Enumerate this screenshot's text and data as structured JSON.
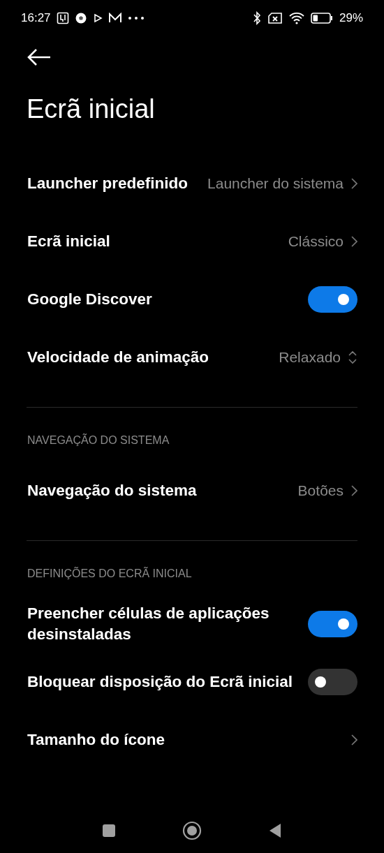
{
  "status_bar": {
    "time": "16:27",
    "battery_text": "29%"
  },
  "title": "Ecrã inicial",
  "sections": [
    {
      "items": [
        {
          "kind": "link",
          "label": "Launcher predefinido",
          "value": "Launcher do sistema"
        },
        {
          "kind": "link",
          "label": "Ecrã inicial",
          "value": "Clássico"
        },
        {
          "kind": "toggle",
          "label": "Google Discover",
          "on": true
        },
        {
          "kind": "select",
          "label": "Velocidade de animação",
          "value": "Relaxado"
        }
      ]
    },
    {
      "header": "NAVEGAÇÃO DO SISTEMA",
      "items": [
        {
          "kind": "link",
          "label": "Navegação do sistema",
          "value": "Botões"
        }
      ]
    },
    {
      "header": "DEFINIÇÕES DO ECRÃ INICIAL",
      "items": [
        {
          "kind": "toggle",
          "label": "Preencher células de aplicações desinstaladas",
          "on": true
        },
        {
          "kind": "toggle",
          "label": "Bloquear disposição do Ecrã inicial",
          "on": false
        },
        {
          "kind": "link",
          "label": "Tamanho do ícone"
        }
      ]
    }
  ]
}
